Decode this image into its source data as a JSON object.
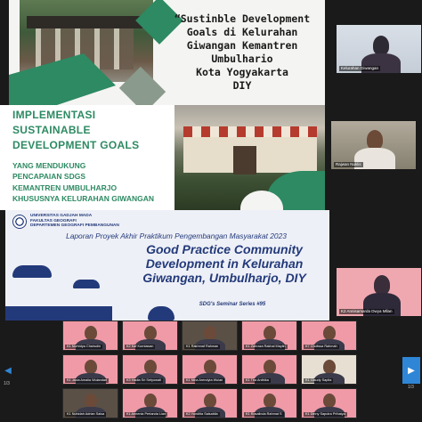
{
  "slide1": {
    "title": "“Sustinble Development\nGoals di Kelurahan\nGiwangan Kemantren\nUmbulhario\nKota Yogyakarta\nDIY"
  },
  "slide2": {
    "heading": "IMPLEMENTASI\nSUSTAINABLE\nDEVELOPMENT GOALS",
    "subheading": "YANG MENDUKUNG\nPENCAPAIAN SDGS\nKEMANTREN UMBULHARJO\nKHUSUSNYA KELURAHAN GIWANGAN"
  },
  "slide3": {
    "institution": "UNIVERSITAS GADJAH MADA\nFAKULTAS GEOGRAFI\nDEPARTEMEN GEOGRAFI PEMBANGUNAN",
    "report": "Laporan Proyek Akhir Praktikum Pengembangan Masyarakat 2023",
    "title": "Good Practice Community\nDevelopment in Kelurahan\nGiwangan, Umbulharjo, DIY",
    "series": "SDG's Seminar Series #95"
  },
  "side_tiles": [
    {
      "name": "Kelurahan Giwangan"
    },
    {
      "name": "Rajwan Nuklis"
    },
    {
      "name": "K2 Annisamarda Dwya Mllan"
    }
  ],
  "gallery": [
    {
      "name": "K1 Nurhidya Chairudin"
    },
    {
      "name": "K2 Kaf Kurniawan"
    },
    {
      "name": "K1 Rakhmaf Rahman"
    },
    {
      "name": "K1 Zahraza Rakhal Maylin"
    },
    {
      "name": "K7 Cholissa Rahmah"
    },
    {
      "name": "K1 Jacia Amalia Wulandari"
    },
    {
      "name": "K3 Hadia Sri Setyowati"
    },
    {
      "name": "K1 Nina Arendyta Wulan"
    },
    {
      "name": "K1 Tha Ardhika"
    },
    {
      "name": "K1 Claudy Sapita"
    },
    {
      "name": "K1 Nuhidah Adrian Salsa"
    },
    {
      "name": "K1 Annenia Pertanda Lian"
    },
    {
      "name": "K2 Yunditia Salsabila"
    },
    {
      "name": "K1 Rosalinda Rahmat S"
    },
    {
      "name": "K1 Dinny Saputra Prihatya"
    }
  ],
  "pager": {
    "left": "1/3",
    "right": "1/3"
  },
  "colors": {
    "green": "#2d8a63",
    "navy": "#233a7a",
    "zoom_blue": "#2f86d6",
    "tile_pink": "#f09aa7"
  }
}
